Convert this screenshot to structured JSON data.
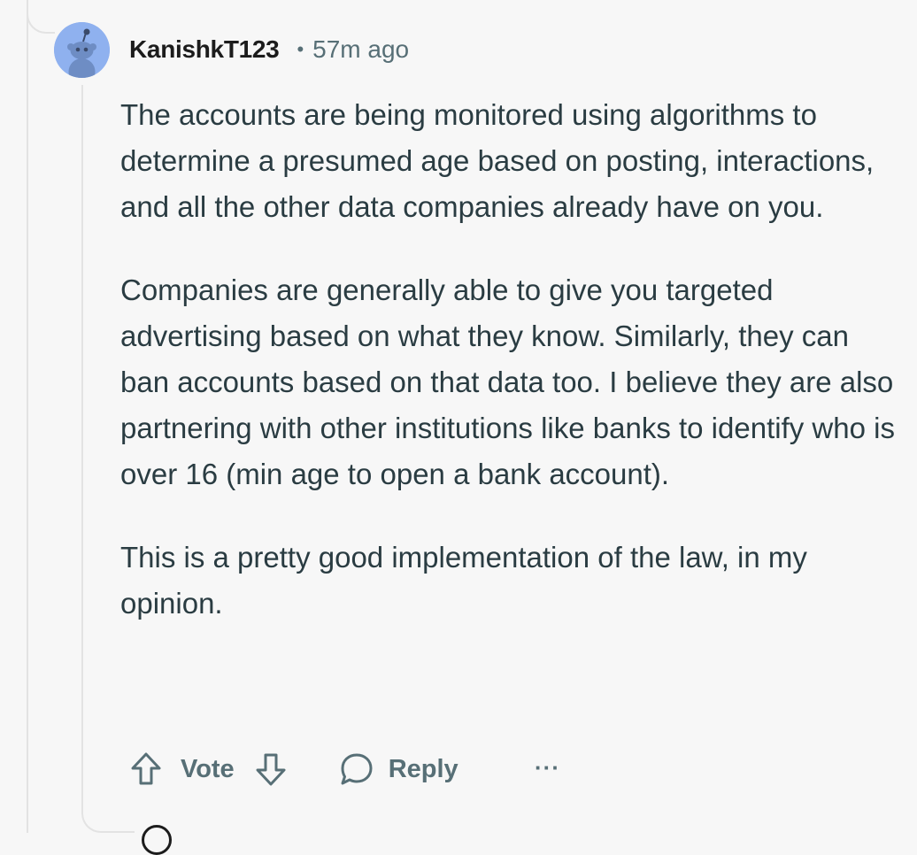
{
  "comment": {
    "username": "KanishkT123",
    "separator": "•",
    "timestamp": "57m ago",
    "avatar_icon": "reddit-snoo-icon",
    "avatar_color": "#8fb1ef",
    "paragraphs": [
      "The accounts are being monitored using algorithms to determine a presumed age based on posting, interactions, and all the other data companies already have on you.",
      "Companies are generally able to give you targeted advertising based on what they know. Similarly, they can ban accounts based on that data too. I believe they are also partnering with other institutions like banks to identify who is over 16 (min age to open a bank account).",
      "This is a pretty good implementation of the law, in my opinion."
    ],
    "actions": {
      "upvote_icon": "arrow-up-icon",
      "vote_label": "Vote",
      "downvote_icon": "arrow-down-icon",
      "reply_icon": "speech-bubble-icon",
      "reply_label": "Reply",
      "more_label": "···"
    }
  },
  "colors": {
    "background": "#f7f7f7",
    "meta_text": "#576f76",
    "body_text": "#2a3c42",
    "thread_line": "#e3e3e3"
  }
}
